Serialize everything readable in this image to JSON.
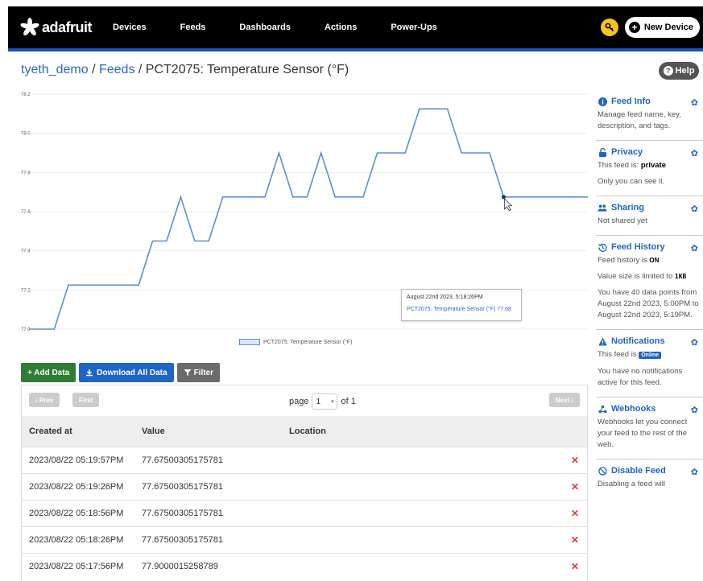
{
  "nav": {
    "brand": "adafruit",
    "links": [
      "Devices",
      "Feeds",
      "Dashboards",
      "Actions",
      "Power-Ups"
    ],
    "new_device": "New Device"
  },
  "breadcrumb": {
    "user": "tyeth_demo",
    "sep": "/",
    "feeds": "Feeds",
    "current": "PCT2075: Temperature Sensor (°F)"
  },
  "help": "Help",
  "chart_data": {
    "type": "line",
    "x": [
      1,
      2,
      3,
      4,
      5,
      6,
      7,
      8,
      9,
      10,
      11,
      12,
      13,
      14,
      15,
      16,
      17,
      18,
      19,
      20,
      21,
      22,
      23,
      24,
      25,
      26,
      27,
      28,
      29,
      30,
      31,
      32,
      33,
      34,
      35,
      36,
      37,
      38,
      39,
      40
    ],
    "series": [
      {
        "name": "PCT2075: Temperature Sensor (°F)",
        "values": [
          77.0,
          77.0,
          77.225,
          77.225,
          77.225,
          77.225,
          77.225,
          77.225,
          77.45,
          77.45,
          77.675,
          77.45,
          77.45,
          77.675,
          77.675,
          77.675,
          77.675,
          77.9,
          77.675,
          77.675,
          77.9,
          77.675,
          77.675,
          77.675,
          77.9,
          77.9,
          77.9,
          78.125,
          78.125,
          78.125,
          77.9,
          77.9,
          77.9,
          77.675,
          77.675,
          77.675,
          77.675,
          77.675,
          77.675,
          77.675
        ]
      }
    ],
    "y_ticks": [
      "78.2",
      "78.0",
      "77.8",
      "77.6",
      "77.4",
      "77.2",
      "77.0"
    ],
    "ylim": [
      77.0,
      78.2
    ],
    "tooltip": {
      "time": "August 22nd 2023, 5:18:26PM",
      "series": "PCT2075: Temperature Sensor (°F)",
      "value": "77.68"
    },
    "color": "#5b8fd3"
  },
  "actions": {
    "add": "+ Add Data",
    "download": "Download All Data",
    "filter": "Filter"
  },
  "pager": {
    "prev": "Prev",
    "first": "First",
    "next": "Next",
    "page_label": "page",
    "page_value": "1",
    "of_label": "of 1"
  },
  "table": {
    "headers": [
      "Created at",
      "Value",
      "Location"
    ],
    "rows": [
      [
        "2023/08/22 05:19:57PM",
        "77.67500305175781",
        ""
      ],
      [
        "2023/08/22 05:19:26PM",
        "77.67500305175781",
        ""
      ],
      [
        "2023/08/22 05:18:56PM",
        "77.67500305175781",
        ""
      ],
      [
        "2023/08/22 05:18:26PM",
        "77.67500305175781",
        ""
      ],
      [
        "2023/08/22 05:17:56PM",
        "77.9000015258789",
        ""
      ]
    ],
    "delete_glyph": "✕"
  },
  "sidebar": {
    "feed_info": {
      "title": "Feed Info",
      "text": "Manage feed name, key, description, and tags."
    },
    "privacy": {
      "title": "Privacy",
      "text_prefix": "This feed is: ",
      "status": "private",
      "text2": "Only you can see it."
    },
    "sharing": {
      "title": "Sharing",
      "text": "Not shared yet"
    },
    "history": {
      "title": "Feed History",
      "text1_prefix": "Feed history is ",
      "state": "ON",
      "text2_prefix": "Value size is limited to ",
      "limit": "1KB",
      "text3": "You have 40 data points from August 22nd 2023, 5:00PM to August 22nd 2023, 5:19PM."
    },
    "notifications": {
      "title": "Notifications",
      "text1": "This feed is ",
      "badge": "Online",
      "text2": "You have no notifications active for this feed."
    },
    "webhooks": {
      "title": "Webhooks",
      "text": "Webhooks let you connect your feed to the rest of the web."
    },
    "disable": {
      "title": "Disable Feed",
      "text": "Disabling a feed will"
    }
  }
}
